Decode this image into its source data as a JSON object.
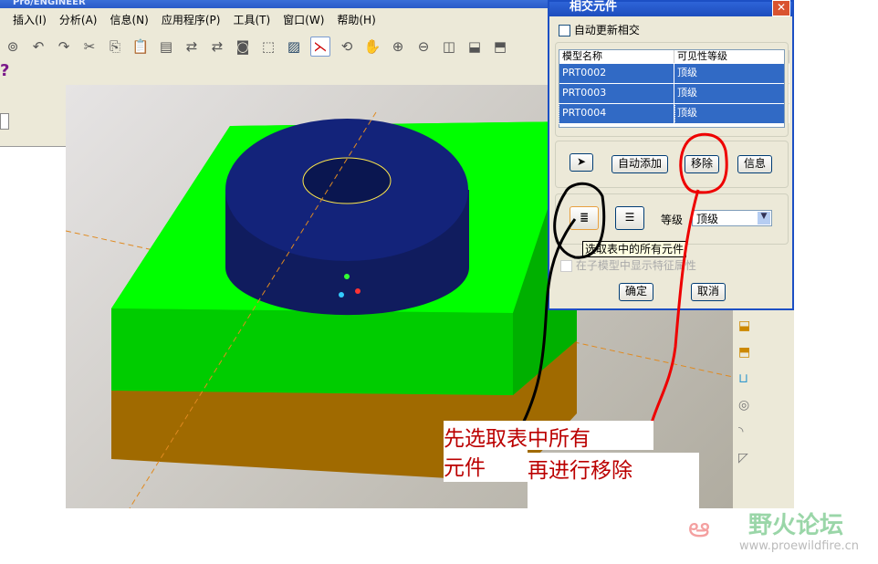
{
  "app": {
    "title": "Pro/ENGINEER"
  },
  "menu": [
    "插入(I)",
    "分析(A)",
    "信息(N)",
    "应用程序(P)",
    "工具(T)",
    "窗口(W)",
    "帮助(H)"
  ],
  "dialog": {
    "title": "相交元件",
    "auto_update_label": "自动更新相交",
    "columns": [
      "模型名称",
      "可见性等级"
    ],
    "rows": [
      {
        "name": "PRT0002",
        "level": "顶级"
      },
      {
        "name": "PRT0003",
        "level": "顶级"
      },
      {
        "name": "PRT0004",
        "level": "顶级"
      }
    ],
    "auto_add": "自动添加",
    "remove": "移除",
    "info": "信息",
    "level_label": "等级",
    "level_value": "顶级",
    "tooltip": "选取表中的所有元件",
    "show_features": "在子模型中显示特征属性",
    "ok": "确定",
    "cancel": "取消"
  },
  "annotations": {
    "line1": "先选取表中所有",
    "line2": "元件",
    "line3": "再进行移除"
  },
  "watermark": {
    "name": "野火论坛",
    "url": "www.proewildfire.cn"
  },
  "colors": {
    "accent": "#316ac5",
    "block_green": "#00ff00",
    "block_brown": "#a06a00",
    "cylinder": "#13237a"
  }
}
